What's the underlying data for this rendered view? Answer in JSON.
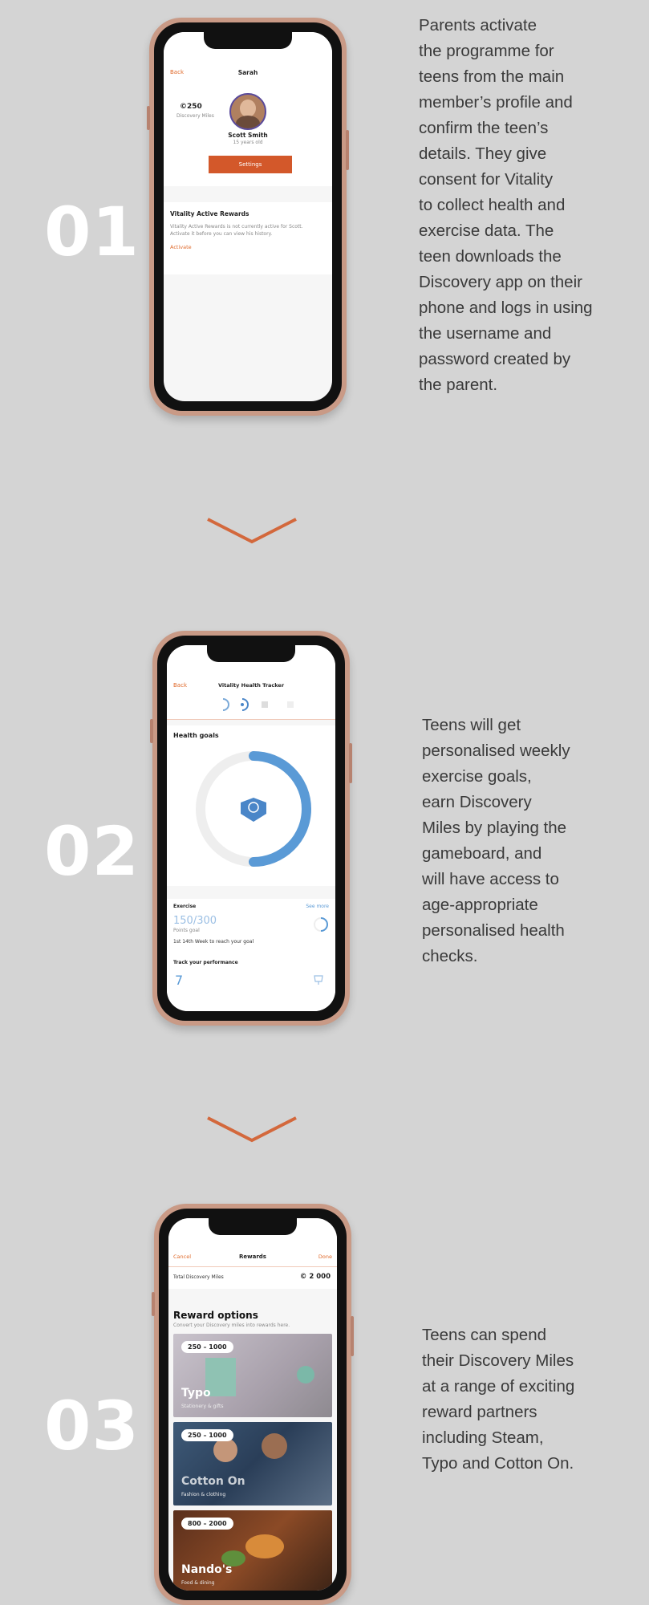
{
  "colors": {
    "background": "#d4d4d4",
    "accent": "#e06a2b",
    "chevron": "#d3683c",
    "text": "#3a3a3a"
  },
  "steps": [
    {
      "number": "01",
      "description": "Parents activate\nthe programme for\nteens from the main\nmember’s profile and\nconfirm the teen’s\ndetails. They give\nconsent for Vitality\nto collect health and\nexercise data. The\nteen downloads the\nDiscovery app on their\nphone and logs in using\nthe username and\npassword created by\nthe parent."
    },
    {
      "number": "02",
      "description": "Teens will get\npersonalised weekly\nexercise goals,\nearn Discovery\nMiles by playing the\ngameboard, and\nwill have access to\nage-appropriate\npersonalised health\nchecks."
    },
    {
      "number": "03",
      "description": "Teens can spend\ntheir Discovery Miles\nat a range of exciting\nreward partners\nincluding Steam,\nTypo and Cotton On."
    }
  ],
  "screen1": {
    "back": "Back",
    "title": "Sarah",
    "miles_value": "250",
    "miles_label": "Discovery Miles",
    "member_name": "Scott Smith",
    "member_age": "15 years old",
    "settings_button": "Settings",
    "section_title": "Vitality Active Rewards",
    "section_text": "Vitality Active Rewards is not currently active for Scott. Activate it before you can view his history.",
    "activate_link": "Activate"
  },
  "screen2": {
    "back": "Back",
    "title": "Vitality Health Tracker",
    "section_title": "Health goals",
    "exercise_label": "Exercise",
    "see_more": "See more",
    "progress": "150/300",
    "points_label": "Points goal",
    "goal_note": "1st 14th Week to reach your goal",
    "track_label": "Track your performance",
    "day_number": "7",
    "progress_fraction": 0.5
  },
  "screen3": {
    "cancel": "Cancel",
    "title": "Rewards",
    "done": "Done",
    "total_label": "Total Discovery Miles",
    "total_value": "2 000",
    "options_title": "Reward options",
    "options_sub": "Convert your Discovery miles into rewards here.",
    "cards": [
      {
        "badge": "250 – 1000",
        "name": "Typo",
        "sub": "Stationery & gifts"
      },
      {
        "badge": "250 – 1000",
        "name": "Cotton On",
        "sub": "Fashion & clothing"
      },
      {
        "badge": "800 – 2000",
        "name": "Nando's",
        "sub": "Food & dining"
      }
    ]
  }
}
